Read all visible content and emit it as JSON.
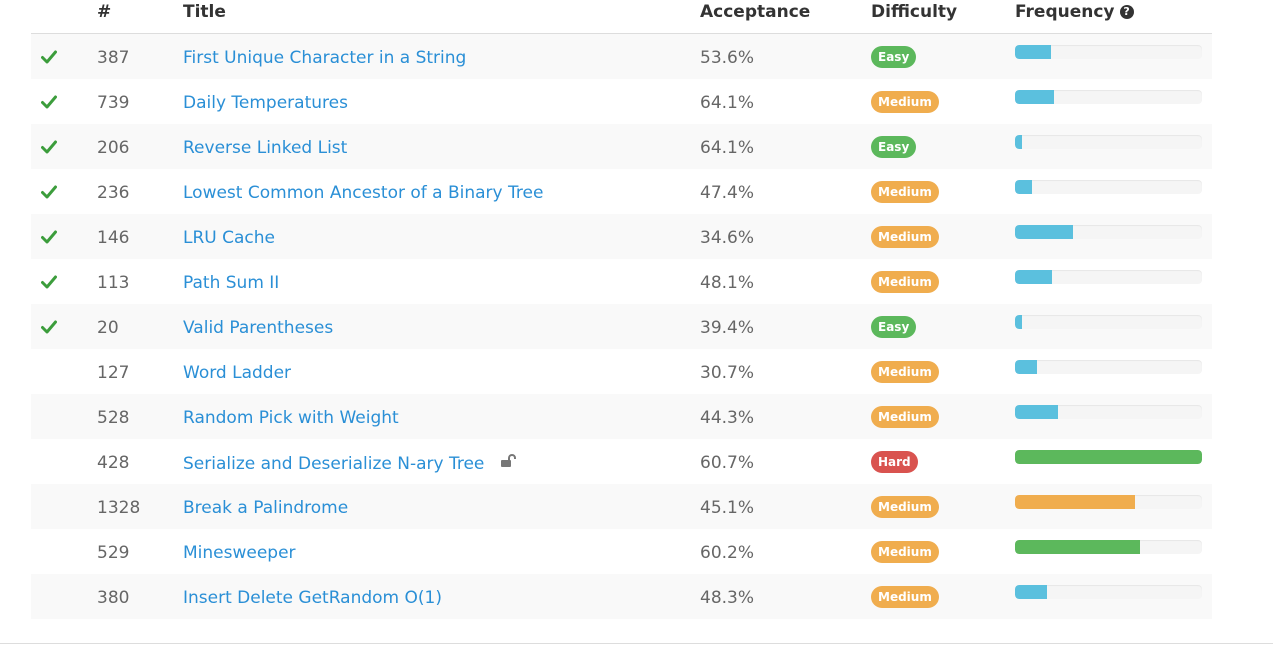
{
  "header": {
    "num": "#",
    "title": "Title",
    "acceptance": "Acceptance",
    "difficulty": "Difficulty",
    "frequency": "Frequency",
    "help_glyph": "?"
  },
  "colors": {
    "easy": "#5cb85c",
    "medium": "#f0ad4e",
    "hard": "#d9534f",
    "bar_blue": "#5bc0de",
    "bar_orange": "#f0ad4e",
    "bar_green": "#5cb85c",
    "link": "#2a8fd6"
  },
  "rows": [
    {
      "solved": true,
      "num": "387",
      "title": "First Unique Character in a String",
      "acceptance": "53.6%",
      "difficulty": "Easy",
      "level": "easy",
      "frequency_pct": 19,
      "bar": "blue",
      "locked": false
    },
    {
      "solved": true,
      "num": "739",
      "title": "Daily Temperatures",
      "acceptance": "64.1%",
      "difficulty": "Medium",
      "level": "medium",
      "frequency_pct": 21,
      "bar": "blue",
      "locked": false
    },
    {
      "solved": true,
      "num": "206",
      "title": "Reverse Linked List",
      "acceptance": "64.1%",
      "difficulty": "Easy",
      "level": "easy",
      "frequency_pct": 4,
      "bar": "blue",
      "locked": false
    },
    {
      "solved": true,
      "num": "236",
      "title": "Lowest Common Ancestor of a Binary Tree",
      "acceptance": "47.4%",
      "difficulty": "Medium",
      "level": "medium",
      "frequency_pct": 9,
      "bar": "blue",
      "locked": false
    },
    {
      "solved": true,
      "num": "146",
      "title": "LRU Cache",
      "acceptance": "34.6%",
      "difficulty": "Medium",
      "level": "medium",
      "frequency_pct": 31,
      "bar": "blue",
      "locked": false
    },
    {
      "solved": true,
      "num": "113",
      "title": "Path Sum II",
      "acceptance": "48.1%",
      "difficulty": "Medium",
      "level": "medium",
      "frequency_pct": 20,
      "bar": "blue",
      "locked": false
    },
    {
      "solved": true,
      "num": "20",
      "title": "Valid Parentheses",
      "acceptance": "39.4%",
      "difficulty": "Easy",
      "level": "easy",
      "frequency_pct": 4,
      "bar": "blue",
      "locked": false
    },
    {
      "solved": false,
      "num": "127",
      "title": "Word Ladder",
      "acceptance": "30.7%",
      "difficulty": "Medium",
      "level": "medium",
      "frequency_pct": 12,
      "bar": "blue",
      "locked": false
    },
    {
      "solved": false,
      "num": "528",
      "title": "Random Pick with Weight",
      "acceptance": "44.3%",
      "difficulty": "Medium",
      "level": "medium",
      "frequency_pct": 23,
      "bar": "blue",
      "locked": false
    },
    {
      "solved": false,
      "num": "428",
      "title": "Serialize and Deserialize N-ary Tree",
      "acceptance": "60.7%",
      "difficulty": "Hard",
      "level": "hard",
      "frequency_pct": 100,
      "bar": "green",
      "locked": true
    },
    {
      "solved": false,
      "num": "1328",
      "title": "Break a Palindrome",
      "acceptance": "45.1%",
      "difficulty": "Medium",
      "level": "medium",
      "frequency_pct": 64,
      "bar": "orange",
      "locked": false
    },
    {
      "solved": false,
      "num": "529",
      "title": "Minesweeper",
      "acceptance": "60.2%",
      "difficulty": "Medium",
      "level": "medium",
      "frequency_pct": 67,
      "bar": "green",
      "locked": false
    },
    {
      "solved": false,
      "num": "380",
      "title": "Insert Delete GetRandom O(1)",
      "acceptance": "48.3%",
      "difficulty": "Medium",
      "level": "medium",
      "frequency_pct": 17,
      "bar": "blue",
      "locked": false
    }
  ]
}
